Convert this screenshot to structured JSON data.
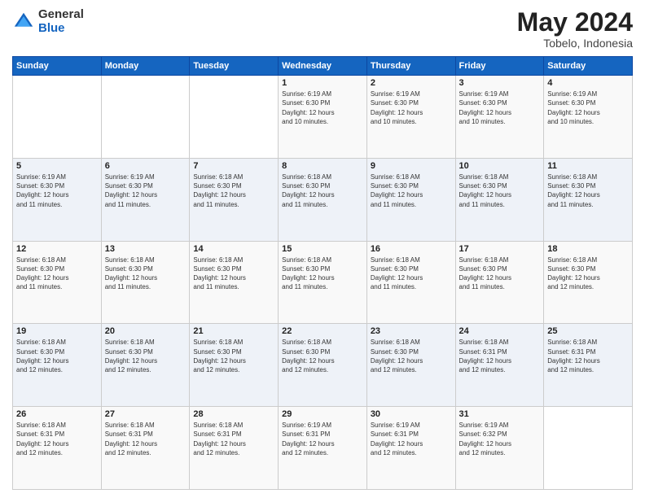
{
  "header": {
    "logo": {
      "general": "General",
      "blue": "Blue"
    },
    "month": "May 2024",
    "location": "Tobelo, Indonesia"
  },
  "weekdays": [
    "Sunday",
    "Monday",
    "Tuesday",
    "Wednesday",
    "Thursday",
    "Friday",
    "Saturday"
  ],
  "weeks": [
    [
      {
        "day": "",
        "info": ""
      },
      {
        "day": "",
        "info": ""
      },
      {
        "day": "",
        "info": ""
      },
      {
        "day": "1",
        "info": "Sunrise: 6:19 AM\nSunset: 6:30 PM\nDaylight: 12 hours\nand 10 minutes."
      },
      {
        "day": "2",
        "info": "Sunrise: 6:19 AM\nSunset: 6:30 PM\nDaylight: 12 hours\nand 10 minutes."
      },
      {
        "day": "3",
        "info": "Sunrise: 6:19 AM\nSunset: 6:30 PM\nDaylight: 12 hours\nand 10 minutes."
      },
      {
        "day": "4",
        "info": "Sunrise: 6:19 AM\nSunset: 6:30 PM\nDaylight: 12 hours\nand 10 minutes."
      }
    ],
    [
      {
        "day": "5",
        "info": "Sunrise: 6:19 AM\nSunset: 6:30 PM\nDaylight: 12 hours\nand 11 minutes."
      },
      {
        "day": "6",
        "info": "Sunrise: 6:19 AM\nSunset: 6:30 PM\nDaylight: 12 hours\nand 11 minutes."
      },
      {
        "day": "7",
        "info": "Sunrise: 6:18 AM\nSunset: 6:30 PM\nDaylight: 12 hours\nand 11 minutes."
      },
      {
        "day": "8",
        "info": "Sunrise: 6:18 AM\nSunset: 6:30 PM\nDaylight: 12 hours\nand 11 minutes."
      },
      {
        "day": "9",
        "info": "Sunrise: 6:18 AM\nSunset: 6:30 PM\nDaylight: 12 hours\nand 11 minutes."
      },
      {
        "day": "10",
        "info": "Sunrise: 6:18 AM\nSunset: 6:30 PM\nDaylight: 12 hours\nand 11 minutes."
      },
      {
        "day": "11",
        "info": "Sunrise: 6:18 AM\nSunset: 6:30 PM\nDaylight: 12 hours\nand 11 minutes."
      }
    ],
    [
      {
        "day": "12",
        "info": "Sunrise: 6:18 AM\nSunset: 6:30 PM\nDaylight: 12 hours\nand 11 minutes."
      },
      {
        "day": "13",
        "info": "Sunrise: 6:18 AM\nSunset: 6:30 PM\nDaylight: 12 hours\nand 11 minutes."
      },
      {
        "day": "14",
        "info": "Sunrise: 6:18 AM\nSunset: 6:30 PM\nDaylight: 12 hours\nand 11 minutes."
      },
      {
        "day": "15",
        "info": "Sunrise: 6:18 AM\nSunset: 6:30 PM\nDaylight: 12 hours\nand 11 minutes."
      },
      {
        "day": "16",
        "info": "Sunrise: 6:18 AM\nSunset: 6:30 PM\nDaylight: 12 hours\nand 11 minutes."
      },
      {
        "day": "17",
        "info": "Sunrise: 6:18 AM\nSunset: 6:30 PM\nDaylight: 12 hours\nand 11 minutes."
      },
      {
        "day": "18",
        "info": "Sunrise: 6:18 AM\nSunset: 6:30 PM\nDaylight: 12 hours\nand 12 minutes."
      }
    ],
    [
      {
        "day": "19",
        "info": "Sunrise: 6:18 AM\nSunset: 6:30 PM\nDaylight: 12 hours\nand 12 minutes."
      },
      {
        "day": "20",
        "info": "Sunrise: 6:18 AM\nSunset: 6:30 PM\nDaylight: 12 hours\nand 12 minutes."
      },
      {
        "day": "21",
        "info": "Sunrise: 6:18 AM\nSunset: 6:30 PM\nDaylight: 12 hours\nand 12 minutes."
      },
      {
        "day": "22",
        "info": "Sunrise: 6:18 AM\nSunset: 6:30 PM\nDaylight: 12 hours\nand 12 minutes."
      },
      {
        "day": "23",
        "info": "Sunrise: 6:18 AM\nSunset: 6:30 PM\nDaylight: 12 hours\nand 12 minutes."
      },
      {
        "day": "24",
        "info": "Sunrise: 6:18 AM\nSunset: 6:31 PM\nDaylight: 12 hours\nand 12 minutes."
      },
      {
        "day": "25",
        "info": "Sunrise: 6:18 AM\nSunset: 6:31 PM\nDaylight: 12 hours\nand 12 minutes."
      }
    ],
    [
      {
        "day": "26",
        "info": "Sunrise: 6:18 AM\nSunset: 6:31 PM\nDaylight: 12 hours\nand 12 minutes."
      },
      {
        "day": "27",
        "info": "Sunrise: 6:18 AM\nSunset: 6:31 PM\nDaylight: 12 hours\nand 12 minutes."
      },
      {
        "day": "28",
        "info": "Sunrise: 6:18 AM\nSunset: 6:31 PM\nDaylight: 12 hours\nand 12 minutes."
      },
      {
        "day": "29",
        "info": "Sunrise: 6:19 AM\nSunset: 6:31 PM\nDaylight: 12 hours\nand 12 minutes."
      },
      {
        "day": "30",
        "info": "Sunrise: 6:19 AM\nSunset: 6:31 PM\nDaylight: 12 hours\nand 12 minutes."
      },
      {
        "day": "31",
        "info": "Sunrise: 6:19 AM\nSunset: 6:32 PM\nDaylight: 12 hours\nand 12 minutes."
      },
      {
        "day": "",
        "info": ""
      }
    ]
  ]
}
